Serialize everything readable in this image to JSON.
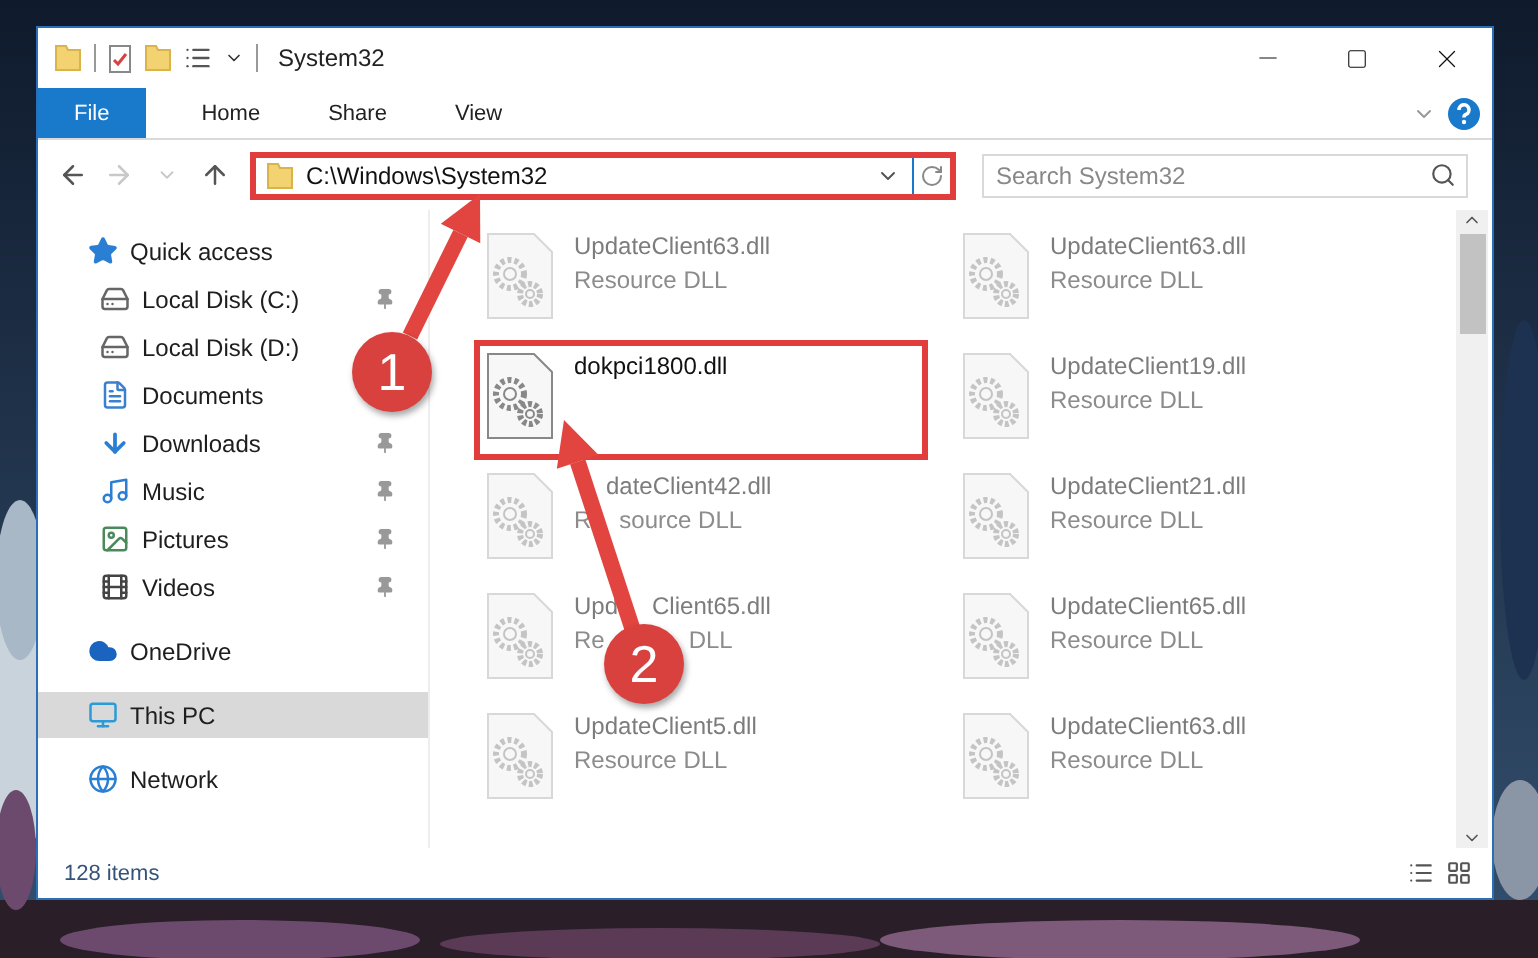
{
  "window": {
    "title": "System32"
  },
  "ribbon": {
    "tabs": [
      {
        "label": "File",
        "selected": true
      },
      {
        "label": "Home",
        "selected": false
      },
      {
        "label": "Share",
        "selected": false
      },
      {
        "label": "View",
        "selected": false
      }
    ]
  },
  "address_bar": {
    "path": "C:\\Windows\\System32",
    "highlighted": true
  },
  "search": {
    "placeholder": "Search System32"
  },
  "sidebar": {
    "items": [
      {
        "label": "Quick access",
        "kind": "star",
        "pinned": false,
        "selected": false,
        "children": [
          {
            "label": "Local Disk (C:)",
            "kind": "windrive",
            "pinned": true,
            "selected": false
          },
          {
            "label": "Local Disk (D:)",
            "kind": "drive",
            "pinned": false,
            "selected": false
          },
          {
            "label": "Documents",
            "kind": "documents",
            "pinned": false,
            "selected": false
          },
          {
            "label": "Downloads",
            "kind": "downloads",
            "pinned": true,
            "selected": false
          },
          {
            "label": "Music",
            "kind": "music",
            "pinned": true,
            "selected": false
          },
          {
            "label": "Pictures",
            "kind": "pictures",
            "pinned": true,
            "selected": false
          },
          {
            "label": "Videos",
            "kind": "videos",
            "pinned": true,
            "selected": false
          }
        ]
      },
      {
        "label": "OneDrive",
        "kind": "cloud",
        "pinned": false,
        "selected": false
      },
      {
        "label": "This PC",
        "kind": "pc",
        "pinned": false,
        "selected": true
      },
      {
        "label": "Network",
        "kind": "network",
        "pinned": false,
        "selected": false
      }
    ]
  },
  "files": [
    {
      "name": [
        "UpdateClient63.dll"
      ],
      "type": [
        "Resource DLL"
      ],
      "faded": true,
      "highlighted": false
    },
    {
      "name": [
        "UpdateClient63.dll"
      ],
      "type": [
        "Resource DLL"
      ],
      "faded": true,
      "highlighted": false
    },
    {
      "name": [
        "dokpci1800.dll"
      ],
      "faded": false,
      "highlighted": true
    },
    {
      "name": [
        "UpdateClient19.dll"
      ],
      "type": [
        "Resource DLL"
      ],
      "faded": true,
      "highlighted": false
    },
    {
      "name": [
        "dateClient42.dll"
      ],
      "type": [
        "R",
        "source DLL"
      ],
      "faded": true,
      "highlighted": false
    },
    {
      "name": [
        "UpdateClient21.dll"
      ],
      "type": [
        "Resource DLL"
      ],
      "faded": true,
      "highlighted": false
    },
    {
      "name": [
        "Upd",
        "Client65.dll"
      ],
      "type": [
        "Re",
        "DLL"
      ],
      "faded": true,
      "highlighted": false
    },
    {
      "name": [
        "UpdateClient65.dll"
      ],
      "type": [
        "Resource DLL"
      ],
      "faded": true,
      "highlighted": false
    },
    {
      "name": [
        "UpdateClient5.dll"
      ],
      "type": [
        "Resource DLL"
      ],
      "faded": true,
      "highlighted": false
    },
    {
      "name": [
        "UpdateClient63.dll"
      ],
      "type": [
        "Resource DLL"
      ],
      "faded": true,
      "highlighted": false
    }
  ],
  "status_bar": {
    "item_count": "128 items"
  },
  "annotations": [
    {
      "number": "1"
    },
    {
      "number": "2"
    }
  ]
}
